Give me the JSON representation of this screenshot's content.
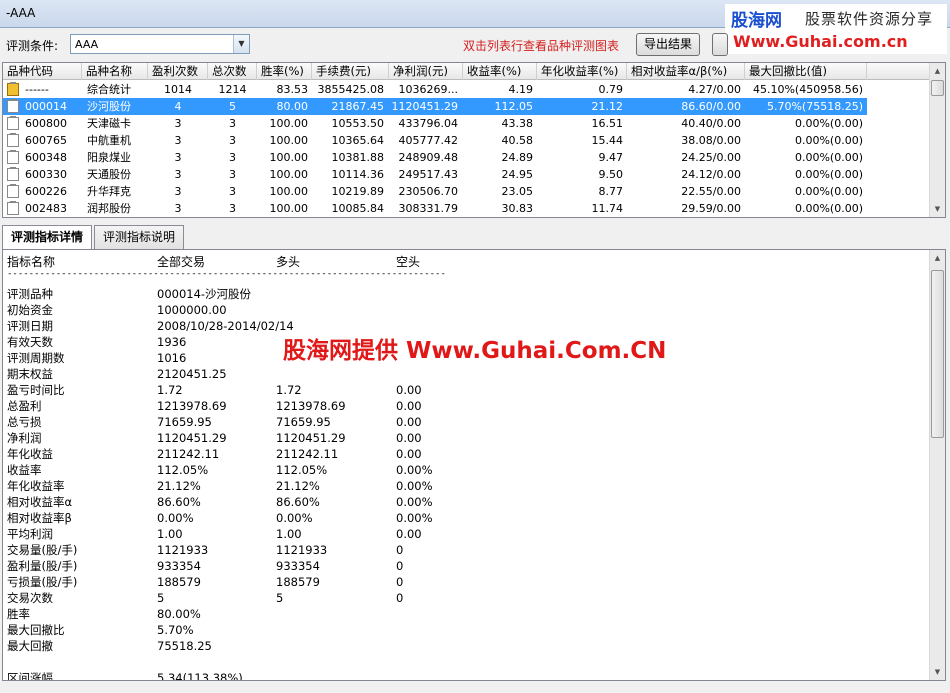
{
  "window": {
    "title": "-AAA"
  },
  "brand": {
    "name": "股海网",
    "slogan": "股票软件资源分享",
    "url": "Www.Guhai.com.cn"
  },
  "filter": {
    "label": "评测条件:",
    "value": "AAA",
    "hint": "双击列表行查看品种评测图表",
    "export_label": "导出结果",
    "extra_label": ""
  },
  "grid": {
    "columns": [
      "品种代码",
      "品种名称",
      "盈利次数",
      "总次数",
      "胜率(%)",
      "手续费(元)",
      "净利润(元)",
      "收益率(%)",
      "年化收益率(%)",
      "相对收益率α/β(%)",
      "最大回撤比(值)"
    ],
    "rows": [
      {
        "code": "------",
        "name": "综合统计",
        "win": "1014",
        "total": "1214",
        "rate": "83.53",
        "fee": "3855425.08",
        "profit": "1036269...",
        "ret": "4.19",
        "annual": "0.79",
        "rel": "4.27/0.00",
        "dd": "45.10%(450958.56)",
        "icon": "summary-icon"
      },
      {
        "code": "000014",
        "name": "沙河股份",
        "win": "4",
        "total": "5",
        "rate": "80.00",
        "fee": "21867.45",
        "profit": "1120451.29",
        "ret": "112.05",
        "annual": "21.12",
        "rel": "86.60/0.00",
        "dd": "5.70%(75518.25)",
        "icon": "clipboard-icon"
      },
      {
        "code": "600800",
        "name": "天津磁卡",
        "win": "3",
        "total": "3",
        "rate": "100.00",
        "fee": "10553.50",
        "profit": "433796.04",
        "ret": "43.38",
        "annual": "16.51",
        "rel": "40.40/0.00",
        "dd": "0.00%(0.00)",
        "icon": "clipboard-icon"
      },
      {
        "code": "600765",
        "name": "中航重机",
        "win": "3",
        "total": "3",
        "rate": "100.00",
        "fee": "10365.64",
        "profit": "405777.42",
        "ret": "40.58",
        "annual": "15.44",
        "rel": "38.08/0.00",
        "dd": "0.00%(0.00)",
        "icon": "clipboard-icon"
      },
      {
        "code": "600348",
        "name": "阳泉煤业",
        "win": "3",
        "total": "3",
        "rate": "100.00",
        "fee": "10381.88",
        "profit": "248909.48",
        "ret": "24.89",
        "annual": "9.47",
        "rel": "24.25/0.00",
        "dd": "0.00%(0.00)",
        "icon": "clipboard-icon"
      },
      {
        "code": "600330",
        "name": "天通股份",
        "win": "3",
        "total": "3",
        "rate": "100.00",
        "fee": "10114.36",
        "profit": "249517.43",
        "ret": "24.95",
        "annual": "9.50",
        "rel": "24.12/0.00",
        "dd": "0.00%(0.00)",
        "icon": "clipboard-icon"
      },
      {
        "code": "600226",
        "name": "升华拜克",
        "win": "3",
        "total": "3",
        "rate": "100.00",
        "fee": "10219.89",
        "profit": "230506.70",
        "ret": "23.05",
        "annual": "8.77",
        "rel": "22.55/0.00",
        "dd": "0.00%(0.00)",
        "icon": "clipboard-icon"
      },
      {
        "code": "002483",
        "name": "润邦股份",
        "win": "3",
        "total": "3",
        "rate": "100.00",
        "fee": "10085.84",
        "profit": "308331.79",
        "ret": "30.83",
        "annual": "11.74",
        "rel": "29.59/0.00",
        "dd": "0.00%(0.00)",
        "icon": "clipboard-icon"
      }
    ]
  },
  "tabs": [
    "评测指标详情",
    "评测指标说明"
  ],
  "detail": {
    "headers": [
      "指标名称",
      "全部交易",
      "多头",
      "空头"
    ],
    "separator": "------------------------------------------------------------------------------------------------",
    "rows": [
      {
        "name": "评测品种",
        "all": "000014-沙河股份",
        "long": "",
        "short": ""
      },
      {
        "name": "初始资金",
        "all": "1000000.00",
        "long": "",
        "short": ""
      },
      {
        "name": "评测日期",
        "all": "2008/10/28-2014/02/14",
        "long": "",
        "short": ""
      },
      {
        "name": "有效天数",
        "all": "1936",
        "long": "",
        "short": ""
      },
      {
        "name": "评测周期数",
        "all": "1016",
        "long": "",
        "short": ""
      },
      {
        "name": "期末权益",
        "all": "2120451.25",
        "long": "",
        "short": ""
      },
      {
        "name": "盈亏时间比",
        "all": "1.72",
        "long": "1.72",
        "short": "0.00"
      },
      {
        "name": "总盈利",
        "all": "1213978.69",
        "long": "1213978.69",
        "short": "0.00"
      },
      {
        "name": "总亏损",
        "all": "71659.95",
        "long": "71659.95",
        "short": "0.00"
      },
      {
        "name": "净利润",
        "all": "1120451.29",
        "long": "1120451.29",
        "short": "0.00"
      },
      {
        "name": "年化收益",
        "all": "211242.11",
        "long": "211242.11",
        "short": "0.00"
      },
      {
        "name": "收益率",
        "all": "112.05%",
        "long": "112.05%",
        "short": "0.00%"
      },
      {
        "name": "年化收益率",
        "all": "21.12%",
        "long": "21.12%",
        "short": "0.00%"
      },
      {
        "name": "相对收益率α",
        "all": "86.60%",
        "long": "86.60%",
        "short": "0.00%"
      },
      {
        "name": "相对收益率β",
        "all": "0.00%",
        "long": "0.00%",
        "short": "0.00%"
      },
      {
        "name": "平均利润",
        "all": "1.00",
        "long": "1.00",
        "short": "0.00"
      },
      {
        "name": "交易量(股/手)",
        "all": "1121933",
        "long": "1121933",
        "short": "0"
      },
      {
        "name": "盈利量(股/手)",
        "all": "933354",
        "long": "933354",
        "short": "0"
      },
      {
        "name": "亏损量(股/手)",
        "all": "188579",
        "long": "188579",
        "short": "0"
      },
      {
        "name": "交易次数",
        "all": "5",
        "long": "5",
        "short": "0"
      },
      {
        "name": "胜率",
        "all": "80.00%",
        "long": "",
        "short": ""
      },
      {
        "name": "最大回撤比",
        "all": "5.70%",
        "long": "",
        "short": ""
      },
      {
        "name": "最大回撤",
        "all": "75518.25",
        "long": "",
        "short": ""
      },
      {
        "name": "",
        "all": "",
        "long": "",
        "short": ""
      },
      {
        "name": "区间涨幅",
        "all": "5.34(113.38%)",
        "long": "",
        "short": ""
      }
    ]
  },
  "watermark": "股海网提供 Www.Guhai.Com.CN"
}
